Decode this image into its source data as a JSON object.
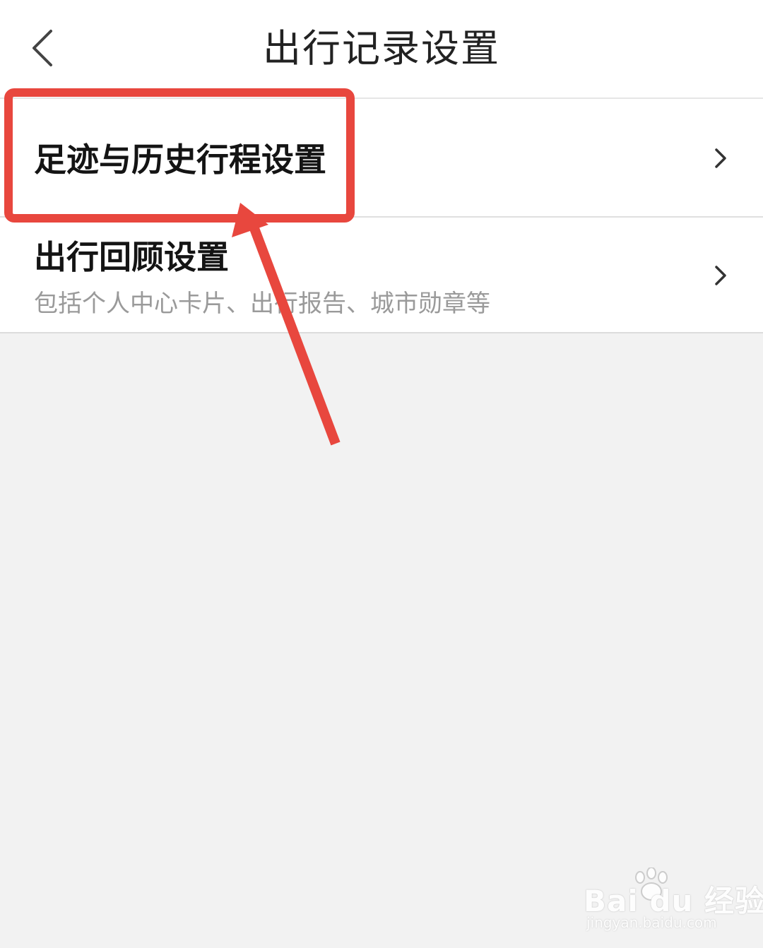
{
  "header": {
    "title": "出行记录设置",
    "back_icon": "chevron-left-icon"
  },
  "settings": {
    "items": [
      {
        "title": "足迹与历史行程设置",
        "subtitle": "",
        "icon": "chevron-right-icon",
        "highlighted": true
      },
      {
        "title": "出行回顾设置",
        "subtitle": "包括个人中心卡片、出行报告、城市勋章等",
        "icon": "chevron-right-icon",
        "highlighted": false
      }
    ]
  },
  "annotation": {
    "color": "#e8473e",
    "shapes": [
      "highlight-box",
      "pointer-arrow"
    ]
  },
  "watermark": {
    "brand": "Bai du 经验",
    "url": "jingyan.baidu.com"
  },
  "colors": {
    "background": "#f2f2f2",
    "surface": "#ffffff",
    "title_text": "#141414",
    "secondary_text": "#9a9a9a",
    "annotation_red": "#e8473e"
  }
}
